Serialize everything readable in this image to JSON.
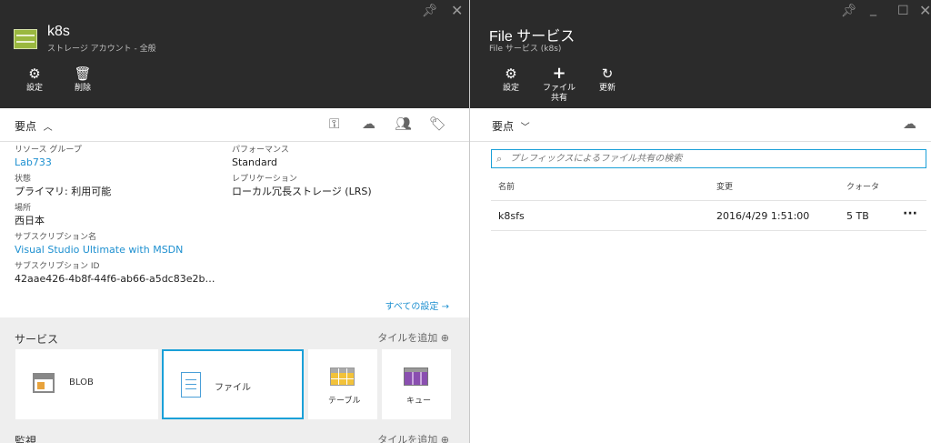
{
  "left_blade": {
    "title": "k8s",
    "subtitle": "ストレージ アカウント - 全般",
    "commands": [
      {
        "label": "設定",
        "icon": "gear-icon"
      },
      {
        "label": "削除",
        "icon": "trash-icon"
      }
    ],
    "essentials_label": "要点",
    "properties_left": [
      {
        "key": "リソース グループ",
        "value": "Lab733"
      },
      {
        "key": "状態",
        "value": "プライマリ: 利用可能"
      },
      {
        "key": "場所",
        "value": "西日本"
      },
      {
        "key": "サブスクリプション名",
        "value": "Visual Studio Ultimate with MSDN"
      },
      {
        "key": "サブスクリプション ID",
        "value": "42aae426-4b8f-44f6-ab66-a5dc83e2b…"
      }
    ],
    "properties_right": [
      {
        "key": "パフォーマンス",
        "value": "Standard"
      },
      {
        "key": "レプリケーション",
        "value": "ローカル冗長ストレージ (LRS)"
      }
    ],
    "all_settings": "すべての設定 →",
    "services_title": "サービス",
    "add_tile": "タイルを追加 ⊕",
    "tiles": [
      {
        "label": "BLOB"
      },
      {
        "label": "ファイル"
      },
      {
        "label": "テーブル"
      },
      {
        "label": "キュー"
      }
    ],
    "monitoring_title": "監視",
    "monitoring_add_tile": "タイルを追加 ⊕"
  },
  "right_blade": {
    "title": "File サービス",
    "subtitle": "File サービス (k8s)",
    "commands": [
      {
        "label": "設定",
        "icon": "gear-icon"
      },
      {
        "label": "ファイル共有",
        "icon": "plus-icon"
      },
      {
        "label": "更新",
        "icon": "refresh-icon"
      }
    ],
    "essentials_label": "要点",
    "search_placeholder": "プレフィックスによるファイル共有の検索",
    "columns": [
      "名前",
      "変更",
      "クォータ"
    ],
    "rows": [
      {
        "name": "k8sfs",
        "modified": "2016/4/29 1:51:00",
        "quota": "5 TB",
        "more": "···"
      }
    ]
  }
}
